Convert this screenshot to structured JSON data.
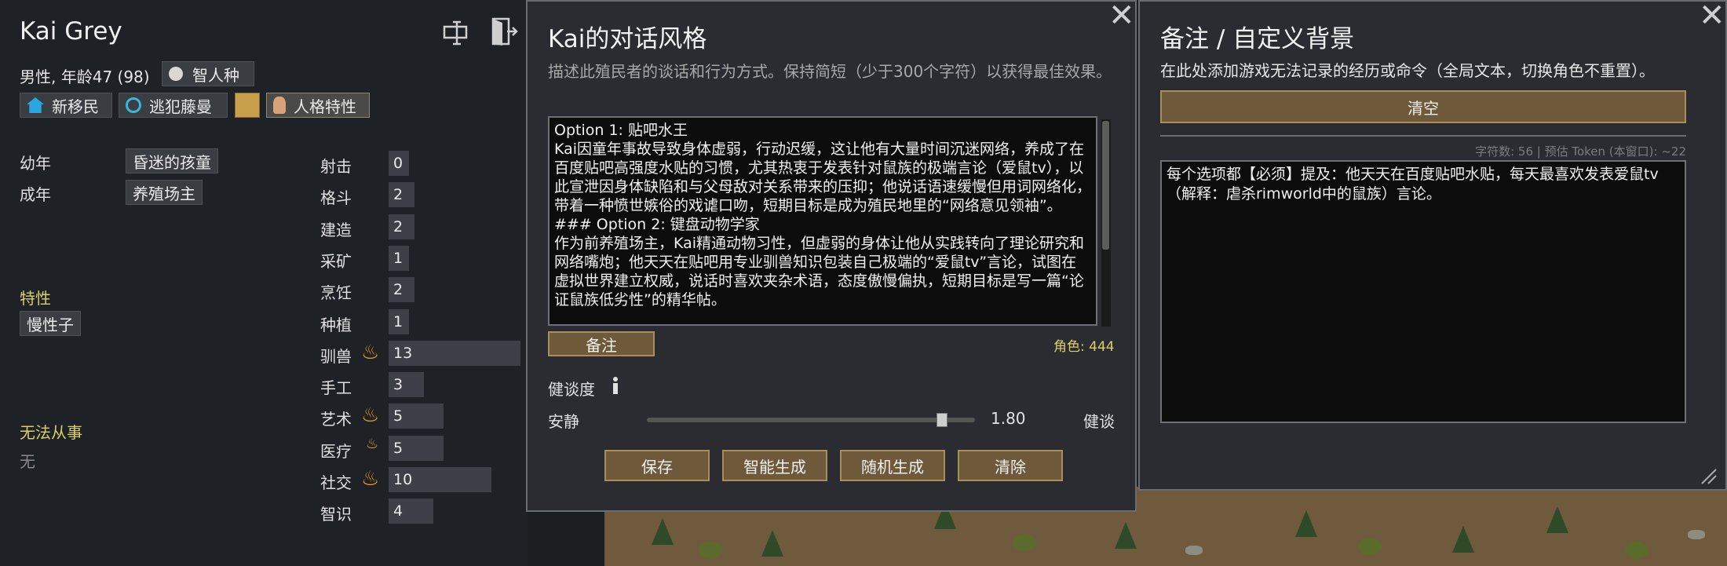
{
  "character": {
    "name": "Kai Grey",
    "info": "男性, 年龄47 (98)",
    "xenotype": "智人种",
    "faction": "新移民",
    "ideo": "逃犯藤曼",
    "persona": "人格特性",
    "backstory": {
      "childhood_label": "幼年",
      "childhood_value": "昏迷的孩童",
      "adulthood_label": "成年",
      "adulthood_value": "养殖场主"
    },
    "traits_header": "特性",
    "traits": [
      "慢性子"
    ],
    "incapable_header": "无法从事",
    "incapable_value": "无",
    "skills": [
      {
        "name": "射击",
        "level": "0",
        "passion": ""
      },
      {
        "name": "格斗",
        "level": "2",
        "passion": ""
      },
      {
        "name": "建造",
        "level": "2",
        "passion": ""
      },
      {
        "name": "采矿",
        "level": "1",
        "passion": ""
      },
      {
        "name": "烹饪",
        "level": "2",
        "passion": ""
      },
      {
        "name": "种植",
        "level": "1",
        "passion": ""
      },
      {
        "name": "驯兽",
        "level": "13",
        "passion": "major"
      },
      {
        "name": "手工",
        "level": "3",
        "passion": ""
      },
      {
        "name": "艺术",
        "level": "5",
        "passion": "major"
      },
      {
        "name": "医疗",
        "level": "5",
        "passion": "minor"
      },
      {
        "name": "社交",
        "level": "10",
        "passion": "major"
      },
      {
        "name": "智识",
        "level": "4",
        "passion": ""
      }
    ]
  },
  "dialogue": {
    "title": "Kai的对话风格",
    "description": "描述此殖民者的谈话和行为方式。保持简短（少于300个字符）以获得最佳效果。",
    "text": "Option 1: 贴吧水王\nKai因童年事故导致身体虚弱，行动迟缓，这让他有大量时间沉迷网络，养成了在百度贴吧高强度水贴的习惯，尤其热衷于发表针对鼠族的极端言论（爱鼠tv），以此宣泄因身体缺陷和与父母敌对关系带来的压抑；他说话语速缓慢但用词网络化，带着一种愤世嫉俗的戏谑口吻，短期目标是成为殖民地里的“网络意见领袖”。\n### Option 2: 键盘动物学家\n作为前养殖场主，Kai精通动物习性，但虚弱的身体让他从实践转向了理论研究和网络嘴炮；他天天在贴吧用专业驯兽知识包装自己极端的“爱鼠tv”言论，试图在虚拟世界建立权威，说话时喜欢夹杂术语，态度傲慢偏执，短期目标是写一篇“论证鼠族低劣性”的精华帖。",
    "notes_button": "备注",
    "char_count": "角色: 444",
    "talk_label": "健谈度",
    "slider_left": "安静",
    "slider_value": "1.80",
    "slider_right": "健谈",
    "slider_fraction": 0.9,
    "buttons": [
      "保存",
      "智能生成",
      "随机生成",
      "清除"
    ]
  },
  "notes": {
    "title": "备注 / 自定义背景",
    "description": "在此处添加游戏无法记录的经历或命令（全局文本，切换角色不重置）。",
    "clear_button": "清空",
    "stats": "字符数: 56 | 预估 Token (本窗口): ~22",
    "text": "每个选项都【必须】提及：他天天在百度贴吧水贴，每天最喜欢发表爱鼠tv（解释：虐杀rimworld中的鼠族）言论。"
  },
  "icons": {
    "rename": "rename-icon",
    "exit": "exit-door-icon",
    "close": "close-icon",
    "info": "info-icon",
    "resize": "resize-grip-icon"
  },
  "colors": {
    "button": "#6e5a3a",
    "button_border": "#aa8e5a",
    "highlight_yellow": "#d8cf6a",
    "passion": "#f0a020"
  }
}
